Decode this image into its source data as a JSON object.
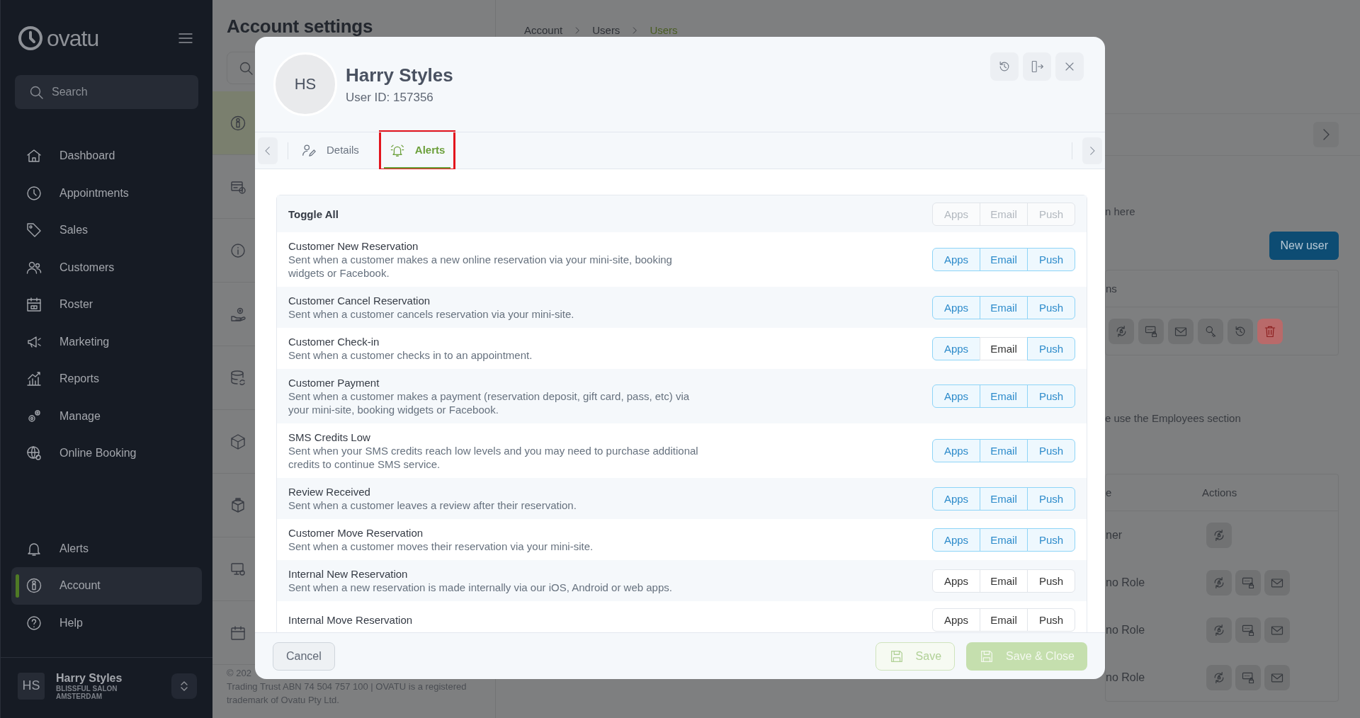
{
  "sidebar": {
    "logo": "ovatu",
    "search": {
      "placeholder": "Search"
    },
    "nav": [
      {
        "label": "Dashboard",
        "selected": false
      },
      {
        "label": "Appointments",
        "selected": false
      },
      {
        "label": "Sales",
        "selected": false
      },
      {
        "label": "Customers",
        "selected": false
      },
      {
        "label": "Roster",
        "selected": false
      },
      {
        "label": "Marketing",
        "selected": false
      },
      {
        "label": "Reports",
        "selected": false
      },
      {
        "label": "Manage",
        "selected": false
      },
      {
        "label": "Online Booking",
        "selected": false
      }
    ],
    "bottom_nav": [
      {
        "label": "Alerts",
        "selected": false
      },
      {
        "label": "Account",
        "selected": true
      },
      {
        "label": "Help",
        "selected": false
      }
    ],
    "user": {
      "initials": "HS",
      "name": "Harry Styles",
      "business": "BLISSFUL SALON AMSTERDAM"
    }
  },
  "page": {
    "title": "Account settings",
    "section_tabs": [
      {
        "selected": true
      },
      {
        "selected": false
      },
      {
        "selected": false
      },
      {
        "selected": false
      },
      {
        "selected": false
      },
      {
        "selected": false
      },
      {
        "selected": false
      },
      {
        "selected": false
      },
      {
        "selected": false
      }
    ],
    "footer": [
      "© 202",
      "Trading Trust ABN 74 504 757 100 | OVATU is a registered",
      "trademark of Ovatu Pty Ltd."
    ],
    "breadcrumb": [
      {
        "label": "Account",
        "current": false
      },
      {
        "label": "Users",
        "current": false
      },
      {
        "label": "Users",
        "current": true
      }
    ],
    "hint": "n here",
    "new_user_button": "New user",
    "table_1": {
      "columns": [
        "ns"
      ]
    },
    "note": "e use the Employees section",
    "table_2": {
      "columns": [
        "e",
        "Actions"
      ],
      "rows": [
        {
          "column_1": "ner",
          "kind": "owner"
        },
        {
          "column_1": "no Role",
          "kind": "staff"
        },
        {
          "column_1": "no Role",
          "kind": "staff"
        },
        {
          "column_1": "no Role",
          "kind": "staff"
        }
      ]
    }
  },
  "modal": {
    "avatar": "HS",
    "name": "Harry Styles",
    "user_id": "User ID: 157356",
    "tabs": [
      {
        "label": "Details",
        "selected": false,
        "highlighted": false
      },
      {
        "label": "Alerts",
        "selected": true,
        "highlighted": true
      }
    ],
    "toggle_all": {
      "label": "Toggle All",
      "channels": [
        {
          "label": "Apps",
          "disabled": true
        },
        {
          "label": "Email",
          "disabled": true
        },
        {
          "label": "Push",
          "disabled": true
        }
      ]
    },
    "alerts": [
      {
        "title": "Customer New Reservation",
        "description": "Sent when a customer makes a new online reservation via your mini-site, booking widgets or Facebook.",
        "channels": [
          {
            "label": "Apps",
            "on": true
          },
          {
            "label": "Email",
            "on": true
          },
          {
            "label": "Push",
            "on": true
          }
        ]
      },
      {
        "title": "Customer Cancel Reservation",
        "description": "Sent when a customer cancels reservation via your mini-site.",
        "channels": [
          {
            "label": "Apps",
            "on": true
          },
          {
            "label": "Email",
            "on": true
          },
          {
            "label": "Push",
            "on": true
          }
        ]
      },
      {
        "title": "Customer Check-in",
        "description": "Sent when a customer checks in to an appointment.",
        "channels": [
          {
            "label": "Apps",
            "on": true
          },
          {
            "label": "Email",
            "on": false
          },
          {
            "label": "Push",
            "on": true
          }
        ]
      },
      {
        "title": "Customer Payment",
        "description": "Sent when a customer makes a payment (reservation deposit, gift card, pass, etc) via your mini-site, booking widgets or Facebook.",
        "channels": [
          {
            "label": "Apps",
            "on": true
          },
          {
            "label": "Email",
            "on": true
          },
          {
            "label": "Push",
            "on": true
          }
        ]
      },
      {
        "title": "SMS Credits Low",
        "description": "Sent when your SMS credits reach low levels and you may need to purchase additional credits to continue SMS service.",
        "channels": [
          {
            "label": "Apps",
            "on": true
          },
          {
            "label": "Email",
            "on": true
          },
          {
            "label": "Push",
            "on": true
          }
        ]
      },
      {
        "title": "Review Received",
        "description": "Sent when a customer leaves a review after their reservation.",
        "channels": [
          {
            "label": "Apps",
            "on": true
          },
          {
            "label": "Email",
            "on": true
          },
          {
            "label": "Push",
            "on": true
          }
        ]
      },
      {
        "title": "Customer Move Reservation",
        "description": "Sent when a customer moves their reservation via your mini-site.",
        "channels": [
          {
            "label": "Apps",
            "on": true
          },
          {
            "label": "Email",
            "on": true
          },
          {
            "label": "Push",
            "on": true
          }
        ]
      },
      {
        "title": "Internal New Reservation",
        "description": "Sent when a new reservation is made internally via our iOS, Android or web apps.",
        "channels": [
          {
            "label": "Apps",
            "on": false
          },
          {
            "label": "Email",
            "on": false
          },
          {
            "label": "Push",
            "on": false
          }
        ]
      },
      {
        "title": "Internal Move Reservation",
        "channels": [
          {
            "label": "Apps",
            "on": false
          },
          {
            "label": "Email",
            "on": false
          },
          {
            "label": "Push",
            "on": false
          }
        ]
      }
    ],
    "buttons": [
      {
        "label": "Cancel",
        "kind": "cancel"
      },
      {
        "label": "Save",
        "kind": "save",
        "disabled": true
      },
      {
        "label": "Save & Close",
        "kind": "save_close",
        "disabled": true
      }
    ]
  }
}
